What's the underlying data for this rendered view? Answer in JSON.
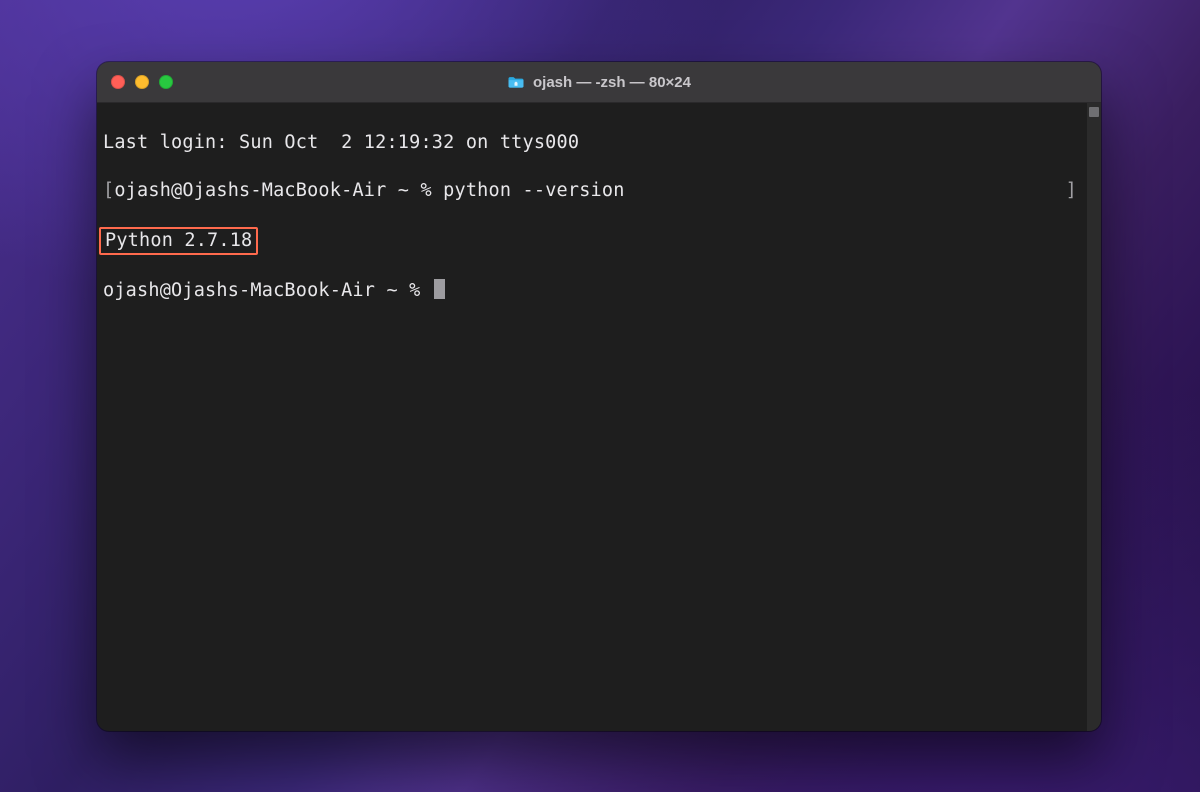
{
  "window": {
    "title": "ojash — -zsh — 80×24"
  },
  "terminal": {
    "last_login": "Last login: Sun Oct  2 12:19:32 on ttys000",
    "prompt1_open": "[",
    "prompt1_text": "ojash@Ojashs-MacBook-Air ~ % ",
    "command1": "python --version",
    "prompt1_close": "]",
    "output_highlighted": "Python 2.7.18",
    "prompt2_text": "ojash@Ojashs-MacBook-Air ~ % "
  }
}
